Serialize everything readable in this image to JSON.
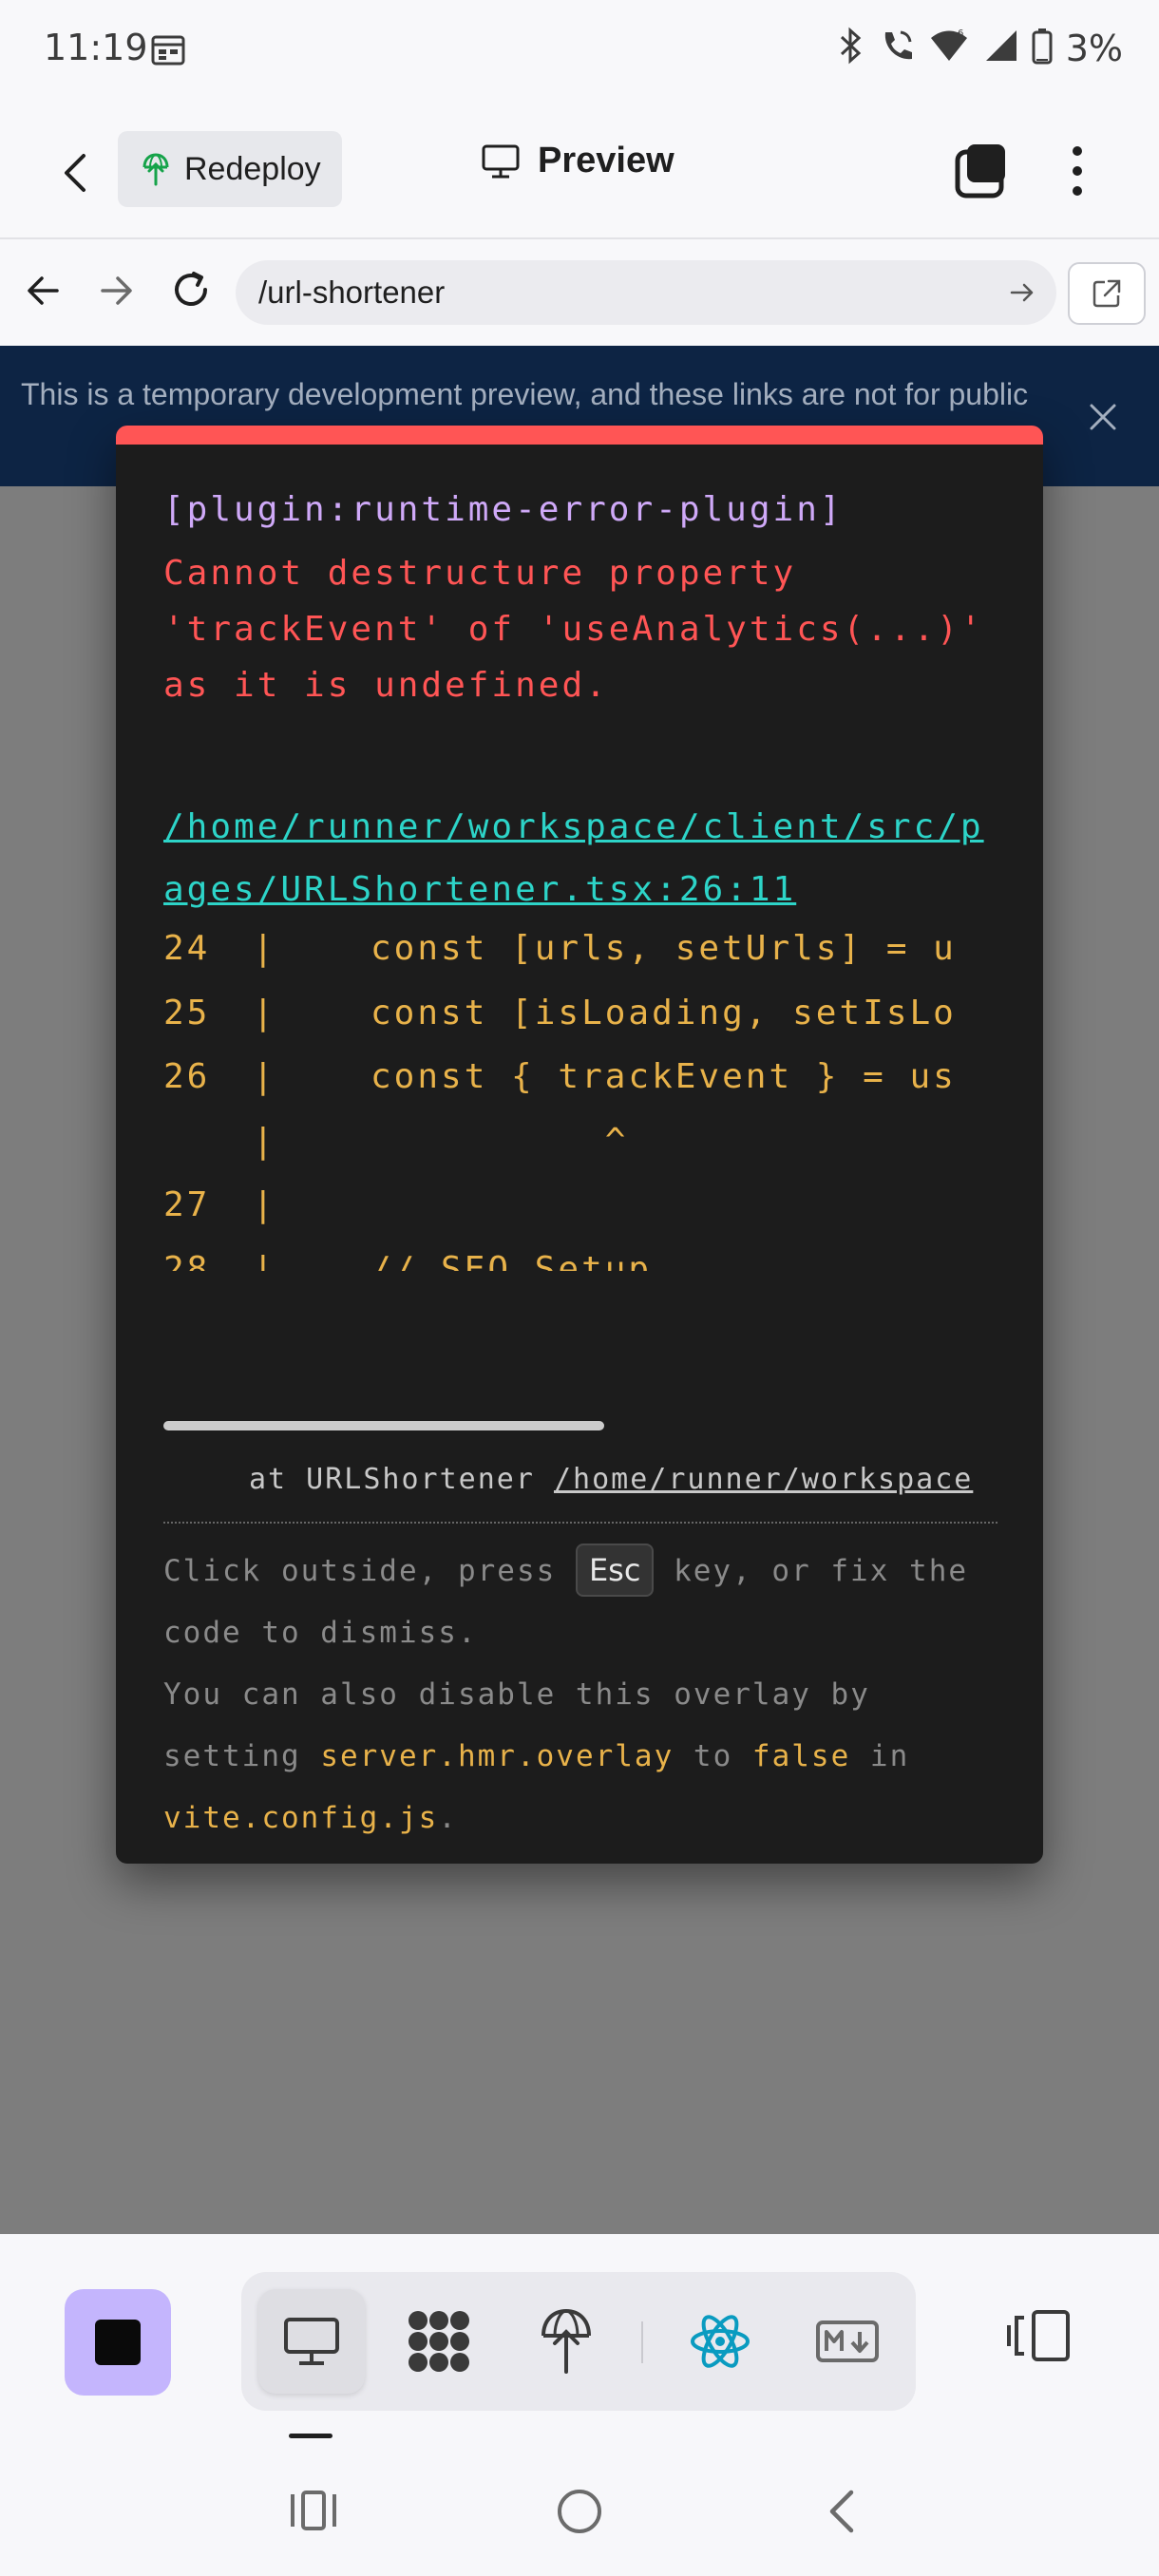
{
  "status_bar": {
    "time": "11:19",
    "battery_text": "3%",
    "icons": [
      "calendar-icon",
      "bluetooth-icon",
      "wifi-calling-icon",
      "wifi-icon",
      "signal-icon",
      "battery-icon"
    ]
  },
  "header": {
    "back_icon": "chevron-left-icon",
    "redeploy_label": "Redeploy",
    "title": "Preview",
    "title_icon": "monitor-icon",
    "tabs_icon": "tabs-icon",
    "more_icon": "more-vertical-icon"
  },
  "url_bar": {
    "url": "/url-shortener"
  },
  "banner": {
    "text": "This is a temporary development preview, and these links are not for public"
  },
  "error_overlay": {
    "plugin": "[plugin:runtime-error-plugin]",
    "message": "Cannot destructure property 'trackEvent' of 'useAnalytics(...)' as it is undefined.",
    "file": "/home/runner/workspace/client/src/pages/URLShortener.tsx:26:11",
    "code_lines": [
      {
        "num": "24",
        "bar": "|",
        "code": "const [urls, setUrls] = u"
      },
      {
        "num": "25",
        "bar": "|",
        "code": "const [isLoading, setIsLo"
      },
      {
        "num": "26",
        "bar": "|",
        "code": "const { trackEvent } = us"
      },
      {
        "num": "",
        "bar": "|",
        "code": "          ^"
      },
      {
        "num": "27",
        "bar": "|",
        "code": ""
      },
      {
        "num": "28",
        "bar": "|",
        "code": "// SEO Setup"
      }
    ],
    "stack_prefix": "at URLShortener ",
    "stack_path": "/home/runner/workspace",
    "tip": {
      "part1": "Click outside, press ",
      "key": "Esc",
      "part2": " key, or fix the code to dismiss.",
      "part3": "You can also disable this overlay by setting ",
      "setting": "server.hmr.overlay",
      "part4": " to ",
      "false_value": "false",
      "part5": " in ",
      "config_file": "vite.config.js",
      "part6": "."
    }
  },
  "toolbar": {
    "stop_icon": "stop-icon",
    "tools": [
      "monitor-icon",
      "workflow-icon",
      "deploy-icon",
      "react-icon",
      "markdown-icon"
    ],
    "active_tool": "monitor-icon",
    "panel_icon": "panel-switch-icon",
    "colors": {
      "stop": "#c4b5fd",
      "react": "#0a9bc0"
    }
  },
  "system_nav": [
    "recents-icon",
    "home-icon",
    "back-icon"
  ],
  "colors": {
    "overlay_accent": "#ff5555",
    "plugin_text": "#cfa9f8",
    "link_text": "#2dd4c8",
    "code_text": "#e8b24a",
    "banner_bg": "#0d2444"
  }
}
